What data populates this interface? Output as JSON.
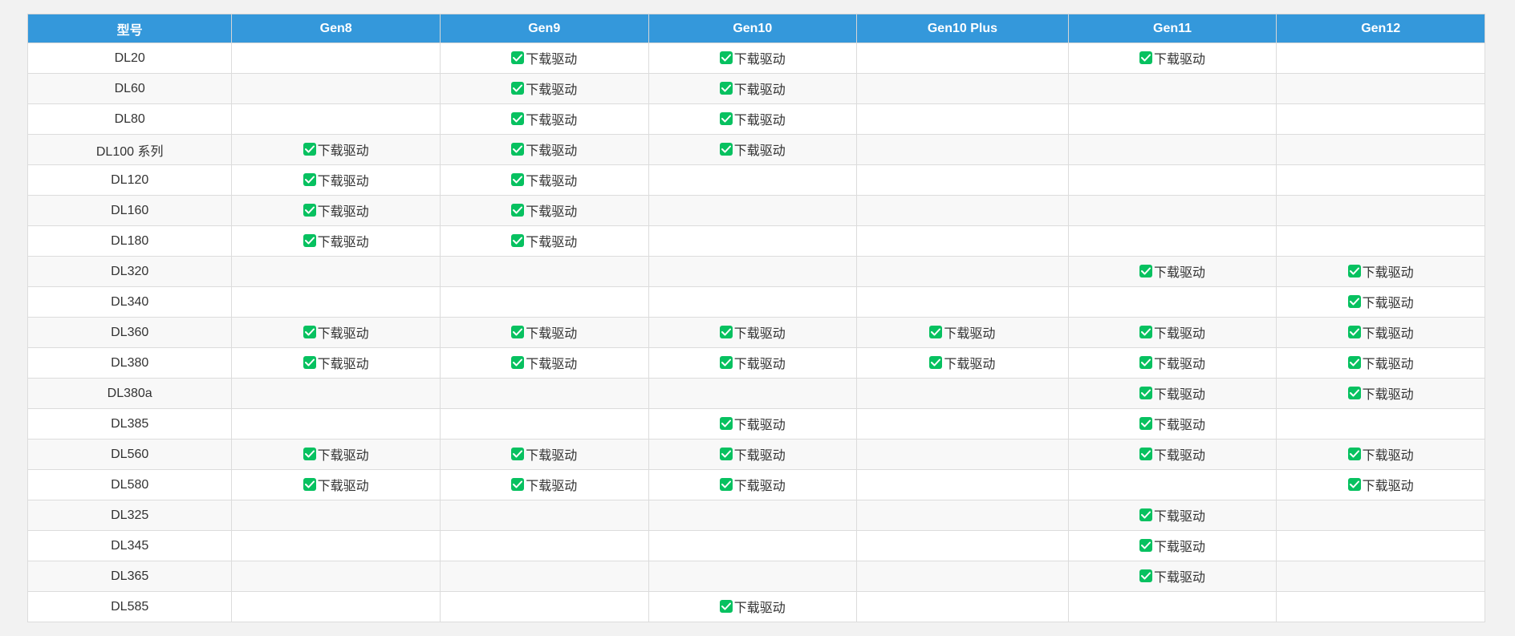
{
  "table": {
    "headers": [
      "型号",
      "Gen8",
      "Gen9",
      "Gen10",
      "Gen10 Plus",
      "Gen11",
      "Gen12"
    ],
    "download_label": "下载驱动",
    "rows": [
      {
        "model": "DL20",
        "cells": [
          false,
          true,
          true,
          false,
          true,
          false
        ]
      },
      {
        "model": "DL60",
        "cells": [
          false,
          true,
          true,
          false,
          false,
          false
        ]
      },
      {
        "model": "DL80",
        "cells": [
          false,
          true,
          true,
          false,
          false,
          false
        ]
      },
      {
        "model": "DL100 系列",
        "cells": [
          true,
          true,
          true,
          false,
          false,
          false
        ]
      },
      {
        "model": "DL120",
        "cells": [
          true,
          true,
          false,
          false,
          false,
          false
        ]
      },
      {
        "model": "DL160",
        "cells": [
          true,
          true,
          false,
          false,
          false,
          false
        ]
      },
      {
        "model": "DL180",
        "cells": [
          true,
          true,
          false,
          false,
          false,
          false
        ]
      },
      {
        "model": "DL320",
        "cells": [
          false,
          false,
          false,
          false,
          true,
          true
        ]
      },
      {
        "model": "DL340",
        "cells": [
          false,
          false,
          false,
          false,
          false,
          true
        ]
      },
      {
        "model": "DL360",
        "cells": [
          true,
          true,
          true,
          true,
          true,
          true
        ]
      },
      {
        "model": "DL380",
        "cells": [
          true,
          true,
          true,
          true,
          true,
          true
        ]
      },
      {
        "model": "DL380a",
        "cells": [
          false,
          false,
          false,
          false,
          true,
          true
        ]
      },
      {
        "model": "DL385",
        "cells": [
          false,
          false,
          true,
          false,
          true,
          false
        ]
      },
      {
        "model": "DL560",
        "cells": [
          true,
          true,
          true,
          false,
          true,
          true
        ]
      },
      {
        "model": "DL580",
        "cells": [
          true,
          true,
          true,
          false,
          false,
          true
        ]
      },
      {
        "model": "DL325",
        "cells": [
          false,
          false,
          false,
          false,
          true,
          false
        ]
      },
      {
        "model": "DL345",
        "cells": [
          false,
          false,
          false,
          false,
          true,
          false
        ]
      },
      {
        "model": "DL365",
        "cells": [
          false,
          false,
          false,
          false,
          true,
          false
        ]
      },
      {
        "model": "DL585",
        "cells": [
          false,
          false,
          true,
          false,
          false,
          false
        ]
      }
    ]
  },
  "colors": {
    "header_bg": "#3498db",
    "check_green": "#07c160"
  }
}
